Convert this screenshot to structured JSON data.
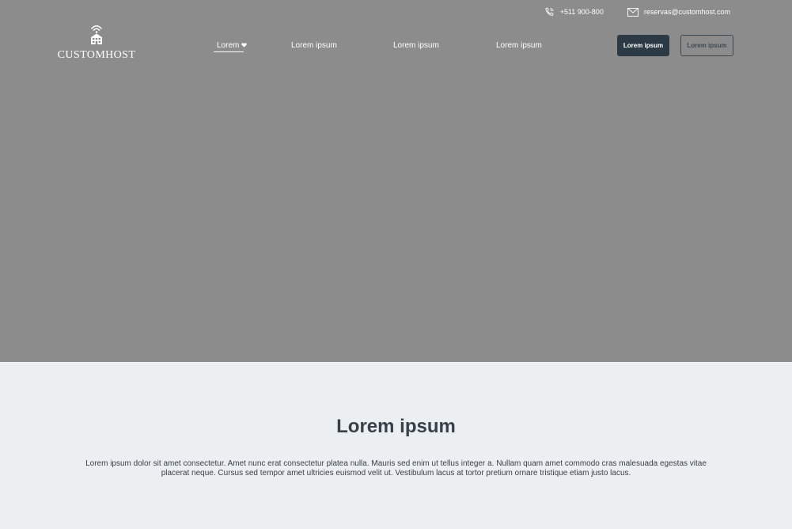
{
  "header": {
    "phone": "+511 900-800",
    "email": "reservas@customhost.com",
    "logo_text": "CUSTOMHOST"
  },
  "nav": {
    "items": [
      {
        "label": "Lorem"
      },
      {
        "label": "Lorem ipsum"
      },
      {
        "label": "Lorem ipsum"
      },
      {
        "label": "Lorem ipsum"
      }
    ],
    "primary_button": "Lorem ipsum",
    "secondary_button": "Lorem ipsum"
  },
  "section": {
    "title": "Lorem ipsum",
    "text": "Lorem ipsum dolor sit amet consectetur. Amet nunc erat consectetur platea nulla. Mauris sed enim ut tellus integer a. Nullam quam amet commodo cras malesuada egestas vitae placerat neque. Cursus sed tempor amet ultricies euismod velit ut. Vestibulum lacus at tortor pretium ornare tristique etiam justo lacus."
  },
  "colors": {
    "hero_bg": "#8c8c8c",
    "page_bg": "#ebeff2",
    "primary_button": "#2b3a44",
    "text_dark": "#384048"
  },
  "icons": {
    "phone": "phone-icon",
    "email": "mail-icon",
    "logo": "hotel-wifi-icon",
    "dropdown": "heart-icon"
  }
}
